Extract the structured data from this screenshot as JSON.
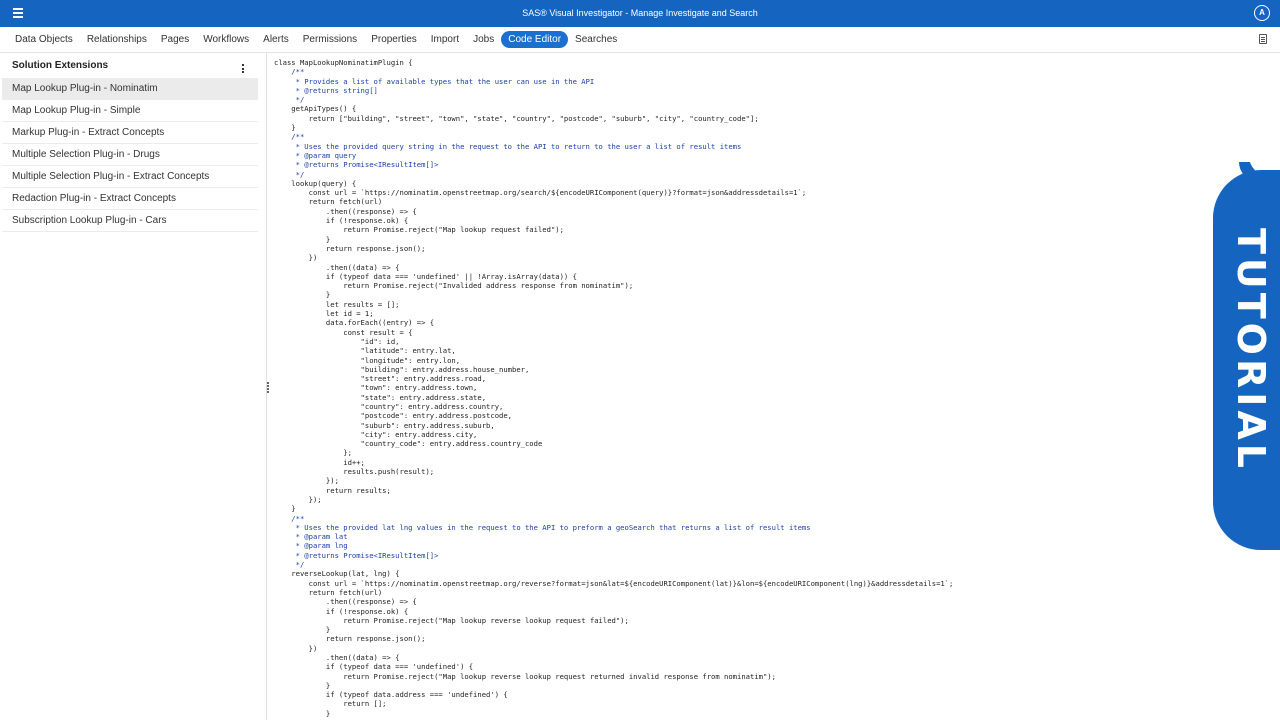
{
  "app": {
    "title": "SAS® Visual Investigator - Manage Investigate and Search",
    "avatar_letter": "A"
  },
  "tabs": [
    {
      "label": "Data Objects",
      "active": false
    },
    {
      "label": "Relationships",
      "active": false
    },
    {
      "label": "Pages",
      "active": false
    },
    {
      "label": "Workflows",
      "active": false
    },
    {
      "label": "Alerts",
      "active": false
    },
    {
      "label": "Permissions",
      "active": false
    },
    {
      "label": "Properties",
      "active": false
    },
    {
      "label": "Import",
      "active": false
    },
    {
      "label": "Jobs",
      "active": false
    },
    {
      "label": "Code Editor",
      "active": true
    },
    {
      "label": "Searches",
      "active": false
    }
  ],
  "sidebar": {
    "header": "Solution Extensions",
    "items": [
      {
        "label": "Map Lookup Plug-in - Nominatim",
        "selected": true
      },
      {
        "label": "Map Lookup Plug-in - Simple",
        "selected": false
      },
      {
        "label": "Markup Plug-in - Extract Concepts",
        "selected": false
      },
      {
        "label": "Multiple Selection Plug-in - Drugs",
        "selected": false
      },
      {
        "label": "Multiple Selection Plug-in - Extract Concepts",
        "selected": false
      },
      {
        "label": "Redaction Plug-in - Extract Concepts",
        "selected": false
      },
      {
        "label": "Subscription Lookup Plug-in - Cars",
        "selected": false
      }
    ]
  },
  "code_lines": [
    "class MapLookupNominatimPlugin {",
    "    /**",
    "     * Provides a list of available types that the user can use in the API",
    "     * @returns string[]",
    "     */",
    "    getApiTypes() {",
    "        return [\"building\", \"street\", \"town\", \"state\", \"country\", \"postcode\", \"suburb\", \"city\", \"country_code\"];",
    "    }",
    "    /**",
    "     * Uses the provided query string in the request to the API to return to the user a list of result items",
    "     * @param query",
    "     * @returns Promise<IResultItem[]>",
    "     */",
    "    lookup(query) {",
    "        const url = `https://nominatim.openstreetmap.org/search/${encodeURIComponent(query)}?format=json&addressdetails=1`;",
    "        return fetch(url)",
    "            .then((response) => {",
    "            if (!response.ok) {",
    "                return Promise.reject(\"Map lookup request failed\");",
    "            }",
    "            return response.json();",
    "        })",
    "            .then((data) => {",
    "            if (typeof data === 'undefined' || !Array.isArray(data)) {",
    "                return Promise.reject(\"Invalided address response from nominatim\");",
    "            }",
    "            let results = [];",
    "            let id = 1;",
    "            data.forEach((entry) => {",
    "                const result = {",
    "                    \"id\": id,",
    "                    \"latitude\": entry.lat,",
    "                    \"longitude\": entry.lon,",
    "                    \"building\": entry.address.house_number,",
    "                    \"street\": entry.address.road,",
    "                    \"town\": entry.address.town,",
    "                    \"state\": entry.address.state,",
    "                    \"country\": entry.address.country,",
    "                    \"postcode\": entry.address.postcode,",
    "                    \"suburb\": entry.address.suburb,",
    "                    \"city\": entry.address.city,",
    "                    \"country_code\": entry.address.country_code",
    "                };",
    "                id++;",
    "                results.push(result);",
    "            });",
    "            return results;",
    "        });",
    "    }",
    "    /**",
    "     * Uses the provided lat lng values in the request to the API to preform a geoSearch that returns a list of result items",
    "     * @param lat",
    "     * @param lng",
    "     * @returns Promise<IResultItem[]>",
    "     */",
    "    reverseLookup(lat, lng) {",
    "        const url = `https://nominatim.openstreetmap.org/reverse?format=json&lat=${encodeURIComponent(lat)}&lon=${encodeURIComponent(lng)}&addressdetails=1`;",
    "        return fetch(url)",
    "            .then((response) => {",
    "            if (!response.ok) {",
    "                return Promise.reject(\"Map lookup reverse lookup request failed\");",
    "            }",
    "            return response.json();",
    "        })",
    "            .then((data) => {",
    "            if (typeof data === 'undefined') {",
    "                return Promise.reject(\"Map lookup reverse lookup request returned invalid response from nominatim\");",
    "            }",
    "            if (typeof data.address === 'undefined') {",
    "                return [];",
    "            }"
  ],
  "badge": {
    "text": "TUTORIAL"
  },
  "colors": {
    "brand": "#1565c0",
    "active_tab": "#1a6fcf",
    "selected_row": "#ebebeb"
  }
}
